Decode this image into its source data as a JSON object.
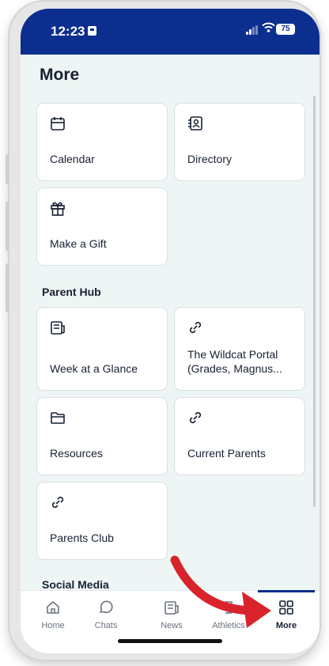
{
  "status_bar": {
    "time": "12:23",
    "battery": "75"
  },
  "page": {
    "title": "More"
  },
  "general_tiles": [
    {
      "label": "Calendar",
      "icon": "calendar-icon"
    },
    {
      "label": "Directory",
      "icon": "directory-icon"
    },
    {
      "label": "Make a Gift",
      "icon": "gift-icon"
    }
  ],
  "parent_hub": {
    "heading": "Parent Hub",
    "tiles": [
      {
        "label": "Week at a Glance",
        "icon": "newspaper-icon"
      },
      {
        "label": "The Wildcat Portal (Grades, Magnus...",
        "icon": "link-icon"
      },
      {
        "label": "Resources",
        "icon": "folder-icon"
      },
      {
        "label": "Current Parents",
        "icon": "link-icon"
      },
      {
        "label": "Parents Club",
        "icon": "link-icon"
      }
    ]
  },
  "social_media": {
    "heading": "Social Media"
  },
  "tab_bar": {
    "tabs": [
      {
        "label": "Home",
        "icon": "home-icon"
      },
      {
        "label": "Chats",
        "icon": "chat-icon"
      },
      {
        "label": "News",
        "icon": "news-icon"
      },
      {
        "label": "Athletics",
        "icon": "trophy-icon"
      },
      {
        "label": "More",
        "icon": "grid-icon",
        "active": true
      }
    ]
  },
  "colors": {
    "header": "#0b2e8f",
    "background": "#eef6f5",
    "arrow": "#d9232b"
  }
}
